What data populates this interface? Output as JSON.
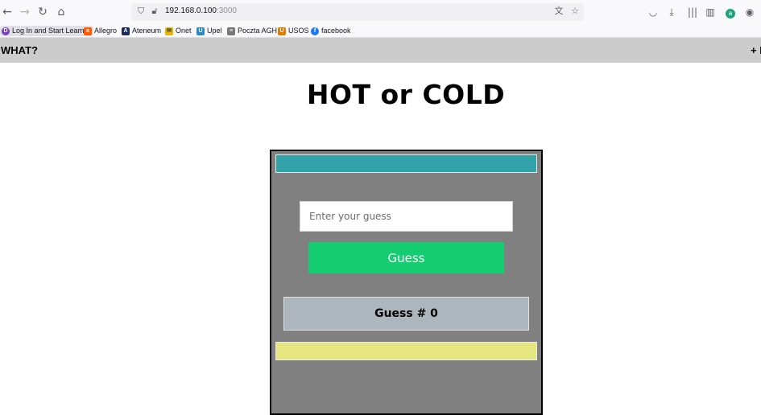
{
  "browser": {
    "url_host": "192.168.0.100",
    "url_port": ":3000",
    "bookmarks": [
      {
        "label": "Log In and Start Learni...",
        "icon_color": "#7a3fbf",
        "icon": "D"
      },
      {
        "label": "Allegro",
        "icon_color": "#ff5a00",
        "icon": "a"
      },
      {
        "label": "Ateneum",
        "icon_color": "#1a2a5a",
        "icon": "A"
      },
      {
        "label": "Onet",
        "icon_color": "#e8b800",
        "icon": "✉"
      },
      {
        "label": "Upel",
        "icon_color": "#2a8ac0",
        "icon": "U"
      },
      {
        "label": "Poczta AGH",
        "icon_color": "#777777",
        "icon": "≡"
      },
      {
        "label": "USOS",
        "icon_color": "#e07b00",
        "icon": "U"
      },
      {
        "label": "facebook",
        "icon_color": "#1877f2",
        "icon": "f"
      }
    ]
  },
  "appbar": {
    "title": "WHAT?",
    "right_label": "+ I"
  },
  "page": {
    "title": "HOT or COLD"
  },
  "game": {
    "input_placeholder": "Enter your guess",
    "button_label": "Guess",
    "count_label": "Guess # 0",
    "colors": {
      "temperature_bar": "#31a2a8",
      "guess_button": "#14cd71",
      "feedback_bar": "#e6e680",
      "box_background": "#808080"
    }
  }
}
